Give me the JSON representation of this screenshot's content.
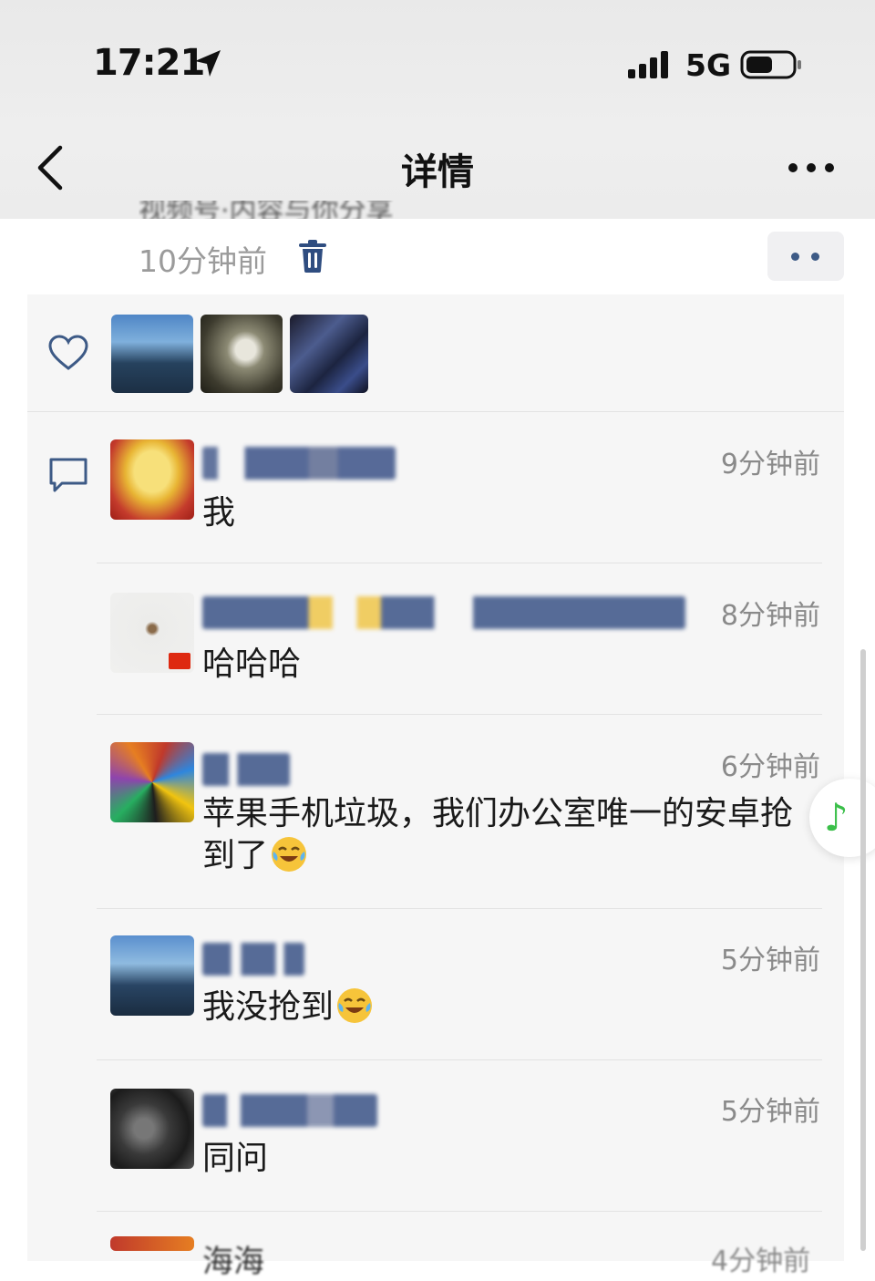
{
  "status_bar": {
    "time": "17:21",
    "network": "5G"
  },
  "nav": {
    "title": "详情"
  },
  "post": {
    "cut_text": "视频号·内容与你分享",
    "time": "10分钟前"
  },
  "comments": [
    {
      "text": "我",
      "time": "9分钟前"
    },
    {
      "text": "哈哈哈",
      "time": "8分钟前"
    },
    {
      "text": "苹果手机垃圾，我们办公室唯一的安卓抢到了",
      "time": "6分钟前"
    },
    {
      "text": "我没抢到",
      "time": "5分钟前"
    },
    {
      "text": "同问",
      "time": "5分钟前"
    }
  ],
  "partial_comment": {
    "name": "海海",
    "time": "4分钟前"
  },
  "colors": {
    "accent_blue": "#3d5a86",
    "music_green": "#3bbf4a",
    "time_gray": "#8a8a8a"
  }
}
